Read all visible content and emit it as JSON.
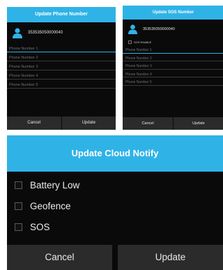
{
  "phone_dialog": {
    "title": "Update Phone Number",
    "device_id": "353535050000040",
    "fields": [
      "Phone Number 1",
      "Phone Number 2",
      "Phone Number 3",
      "Phone Number 4",
      "Phone Number 5"
    ],
    "cancel_label": "Cancel",
    "update_label": "Update"
  },
  "sos_dialog": {
    "title": "Update SOS Number",
    "device_id": "353535050000040",
    "sos_toggle_label": "SOS ENABLE",
    "fields": [
      "Phone Number 1",
      "Phone Number 2",
      "Phone Number 3",
      "Phone Number 4",
      "Phone Number 5"
    ],
    "cancel_label": "Cancel",
    "update_label": "Update"
  },
  "cloud_dialog": {
    "title": "Update Cloud Notify",
    "options": [
      {
        "label": "Battery Low",
        "checked": false
      },
      {
        "label": "Geofence",
        "checked": false
      },
      {
        "label": "SOS",
        "checked": false
      }
    ],
    "cancel_label": "Cancel",
    "update_label": "Update"
  },
  "colors": {
    "accent": "#2fb3e7",
    "dialog_background": "#0a0a0a",
    "button_background": "#2b2b2b"
  },
  "icons": {
    "contact": "person-icon"
  }
}
